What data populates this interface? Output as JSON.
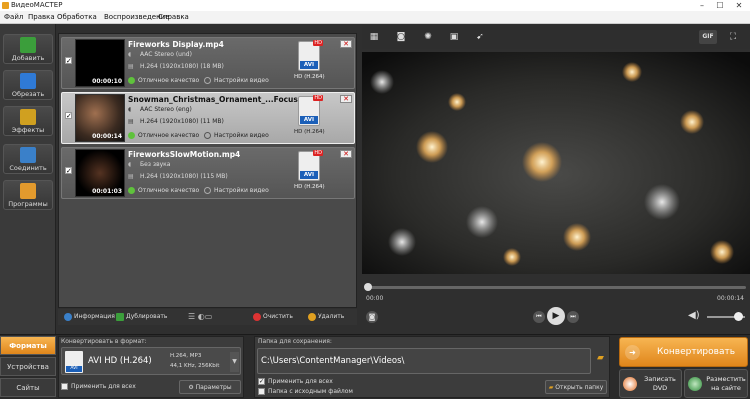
{
  "window": {
    "title": "ВидеоМАСТЕР",
    "min": "–",
    "max": "☐",
    "close": "✕"
  },
  "menu": [
    "Файл",
    "Правка",
    "Обработка",
    "Воспроизведение",
    "Справка"
  ],
  "tools": [
    {
      "label": "Добавить",
      "color": "#3b9e3b"
    },
    {
      "label": "Обрезать",
      "color": "#2f7ad6"
    },
    {
      "label": "Эффекты",
      "color": "#d0a020"
    },
    {
      "label": "Соединить",
      "color": "#3a80c9"
    },
    {
      "label": "Программы",
      "color": "#e39a2d"
    }
  ],
  "files": [
    {
      "name": "Fireworks Display.mp4",
      "audio": "AAC Stereo (und)",
      "video": "H.264 (1920x1080) (18 MB)",
      "quality": "Отличное качество",
      "settings": "Настройки видео",
      "format": "HD (H.264)",
      "duration": "00:00:10",
      "selected": false
    },
    {
      "name": "Snowman_Christmas_Ornament_...Focus.mp4",
      "audio": "AAC Stereo (eng)",
      "video": "H.264 (1920x1080) (11 MB)",
      "quality": "Отличное качество",
      "settings": "Настройки видео",
      "format": "HD (H.264)",
      "duration": "00:00:14",
      "selected": true
    },
    {
      "name": "FireworksSlowMotion.mp4",
      "audio": "Без звука",
      "video": "H.264 (1920x1080) (115 MB)",
      "quality": "Отличное качество",
      "settings": "Настройки видео",
      "format": "HD (H.264)",
      "duration": "00:01:03",
      "selected": false
    }
  ],
  "badge": {
    "hd": "HD",
    "avi": "AVI"
  },
  "list_toolbar": {
    "info": "Информация",
    "duplicate": "Дублировать",
    "clear": "Очистить",
    "delete": "Удалить"
  },
  "player": {
    "gif": "GIF",
    "time_start": "00:00",
    "time_end": "00:00:14"
  },
  "tabs": [
    "Форматы",
    "Устройства",
    "Сайты"
  ],
  "convert": {
    "label": "Конвертировать в формат:",
    "format": "AVI HD (H.264)",
    "spec1": "H.264, MP3",
    "spec2": "44,1 KHz, 256Kbit",
    "apply_all": "Применить для всех",
    "params": "Параметры",
    "avi": "AVI"
  },
  "save": {
    "label": "Папка для сохранения:",
    "path": "C:\\Users\\ContentManager\\Videos\\",
    "apply_all": "Применить для всех",
    "source_folder": "Папка с исходным файлом",
    "open": "Открыть папку"
  },
  "actions": {
    "convert": "Конвертировать",
    "dvd": "Записать DVD",
    "site": "Разместить на сайте"
  }
}
